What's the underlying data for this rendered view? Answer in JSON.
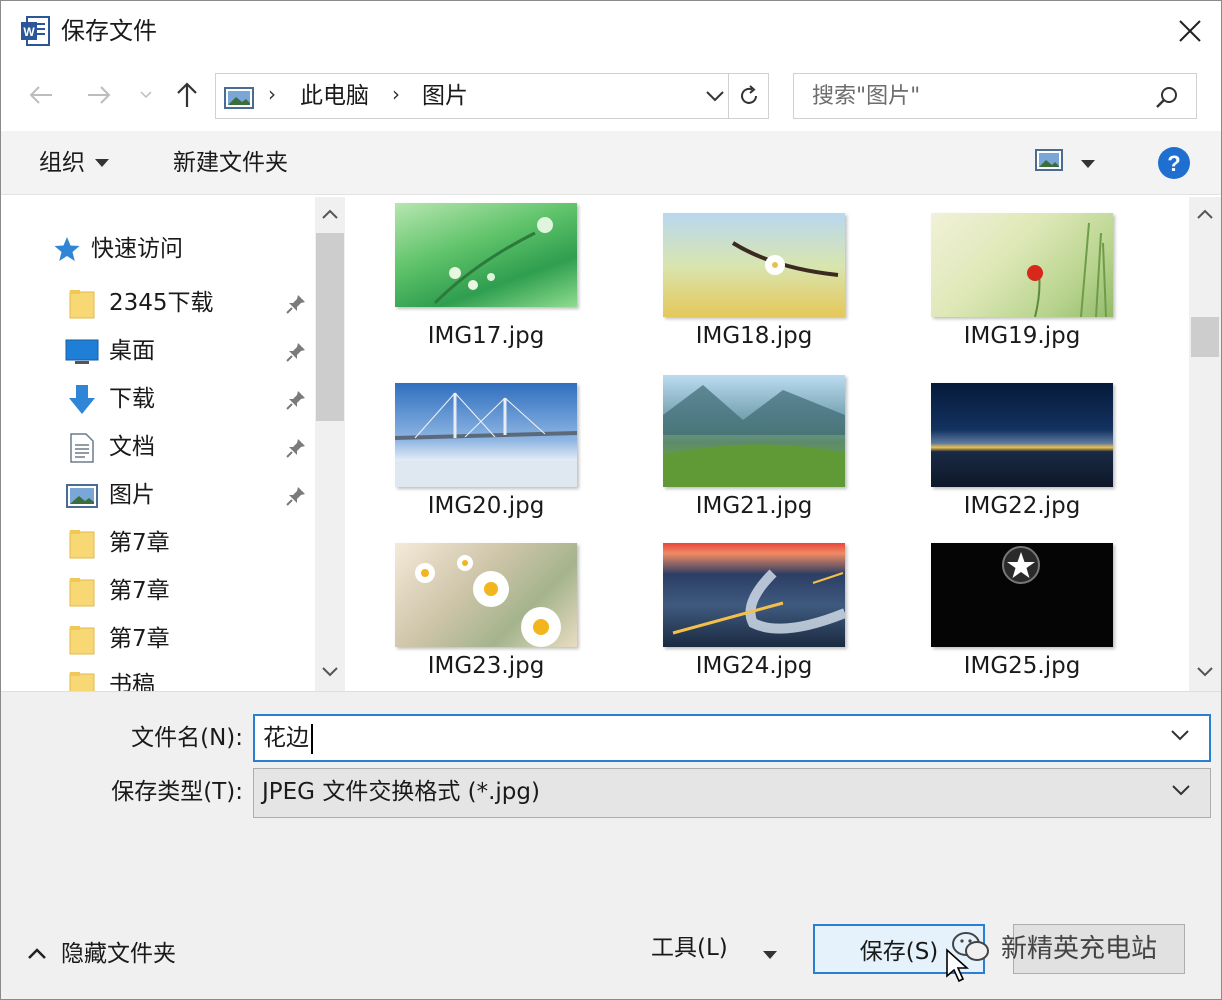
{
  "window": {
    "title": "保存文件",
    "app_icon": "word-icon"
  },
  "nav": {
    "address": [
      "此电脑",
      "图片"
    ],
    "search_placeholder": "搜索\"图片\""
  },
  "toolbar": {
    "organize_label": "组织",
    "new_folder_label": "新建文件夹"
  },
  "sidebar": {
    "quick_access_label": "快速访问",
    "items": [
      {
        "label": "2345下载",
        "icon": "folder-icon",
        "pinned": true
      },
      {
        "label": "桌面",
        "icon": "desktop-icon",
        "pinned": true
      },
      {
        "label": "下载",
        "icon": "download-icon",
        "pinned": true
      },
      {
        "label": "文档",
        "icon": "document-icon",
        "pinned": true
      },
      {
        "label": "图片",
        "icon": "pictures-icon",
        "pinned": true
      },
      {
        "label": "第7章",
        "icon": "folder-icon",
        "pinned": false
      },
      {
        "label": "第7章",
        "icon": "folder-icon",
        "pinned": false
      },
      {
        "label": "第7章",
        "icon": "folder-icon",
        "pinned": false
      },
      {
        "label": "书稿",
        "icon": "folder-icon",
        "pinned": false
      }
    ]
  },
  "files": [
    {
      "name": "IMG17.jpg"
    },
    {
      "name": "IMG18.jpg"
    },
    {
      "name": "IMG19.jpg"
    },
    {
      "name": "IMG20.jpg"
    },
    {
      "name": "IMG21.jpg"
    },
    {
      "name": "IMG22.jpg"
    },
    {
      "name": "IMG23.jpg"
    },
    {
      "name": "IMG24.jpg"
    },
    {
      "name": "IMG25.jpg"
    }
  ],
  "form": {
    "filename_label": "文件名(N):",
    "filename_value": "花边",
    "filetype_label": "保存类型(T):",
    "filetype_value": "JPEG 文件交换格式 (*.jpg)"
  },
  "footer": {
    "hide_folders_label": "隐藏文件夹",
    "tools_label": "工具(L)",
    "save_label": "保存(S)",
    "watermark_text": "新精英充电站"
  },
  "colors": {
    "accent": "#2a7fd4",
    "help": "#1e6fd0"
  }
}
